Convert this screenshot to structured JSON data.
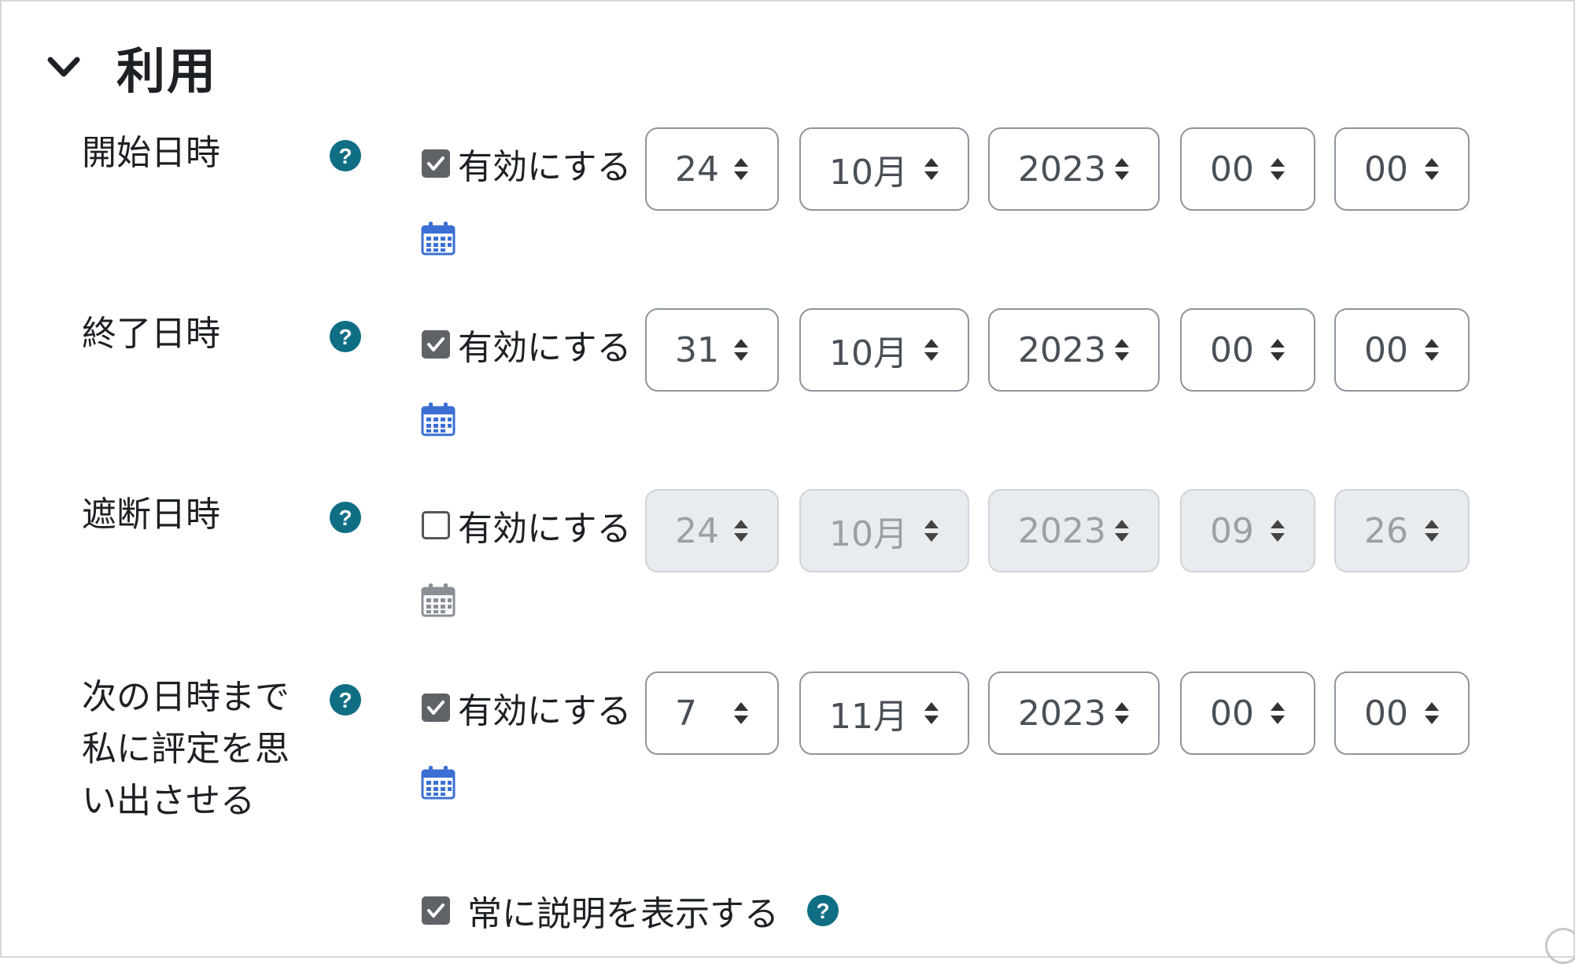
{
  "section": {
    "title": "利用",
    "collapse_icon": "chevron-down-icon"
  },
  "enable_label": "有効にする",
  "rows": [
    {
      "label_lines": [
        "開始日時"
      ],
      "enabled": true,
      "values": {
        "day": "24",
        "month": "10月",
        "year": "2023",
        "hour": "00",
        "minute": "00"
      }
    },
    {
      "label_lines": [
        "終了日時"
      ],
      "enabled": true,
      "values": {
        "day": "31",
        "month": "10月",
        "year": "2023",
        "hour": "00",
        "minute": "00"
      }
    },
    {
      "label_lines": [
        "遮断日時"
      ],
      "enabled": false,
      "values": {
        "day": "24",
        "month": "10月",
        "year": "2023",
        "hour": "09",
        "minute": "26"
      }
    },
    {
      "label_lines": [
        "次の日時まで",
        "私に評定を思",
        "い出させる"
      ],
      "enabled": true,
      "values": {
        "day": "7",
        "month": "11月",
        "year": "2023",
        "hour": "00",
        "minute": "00"
      }
    }
  ],
  "footer": {
    "checked": true,
    "label": "常に説明を表示する"
  },
  "colors": {
    "help_icon": "#0f6e84",
    "calendar_enabled": "#3b6fd4",
    "calendar_disabled": "#8a8f96",
    "checkbox_checked": "#5f6368"
  },
  "icons": {
    "help": "question-circle-icon",
    "calendar": "calendar-icon",
    "select_arrow": "sort-arrows-icon"
  }
}
